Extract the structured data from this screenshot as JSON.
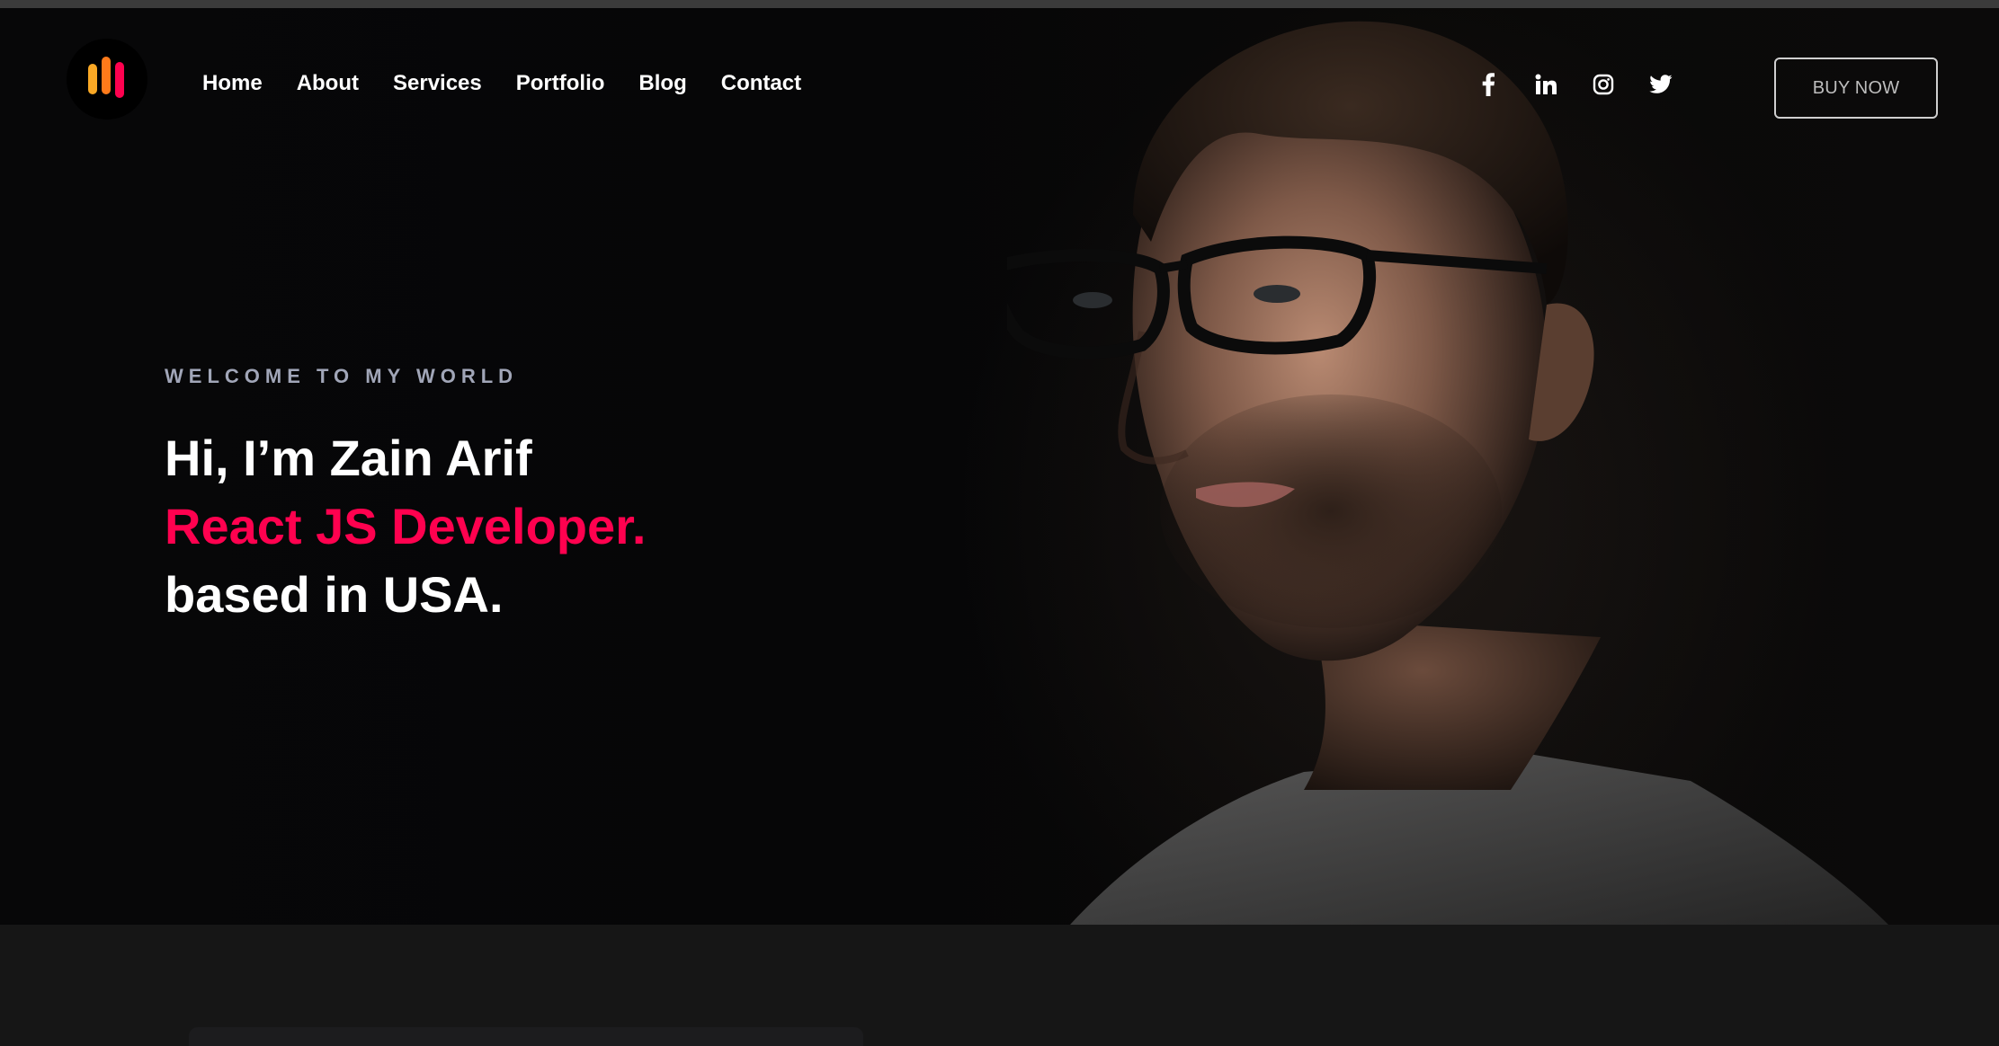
{
  "header": {
    "logo_name": "brand-logo",
    "nav": [
      {
        "label": "Home"
      },
      {
        "label": "About"
      },
      {
        "label": "Services"
      },
      {
        "label": "Portfolio"
      },
      {
        "label": "Blog"
      },
      {
        "label": "Contact"
      }
    ],
    "social": [
      {
        "icon": "facebook-icon"
      },
      {
        "icon": "linkedin-icon"
      },
      {
        "icon": "instagram-icon"
      },
      {
        "icon": "twitter-icon"
      }
    ],
    "buy_label": "BUY NOW"
  },
  "hero": {
    "eyebrow": "WELCOME TO MY WORLD",
    "line1": "Hi, I’m Zain Arif",
    "line2": "React JS Developer.",
    "line3": "based in USA."
  },
  "colors": {
    "accent": "#ff014f",
    "background": "#060607",
    "eyebrow": "#a1a6b8",
    "logo_orange": "#f9a825",
    "logo_red": "#ff014f"
  }
}
